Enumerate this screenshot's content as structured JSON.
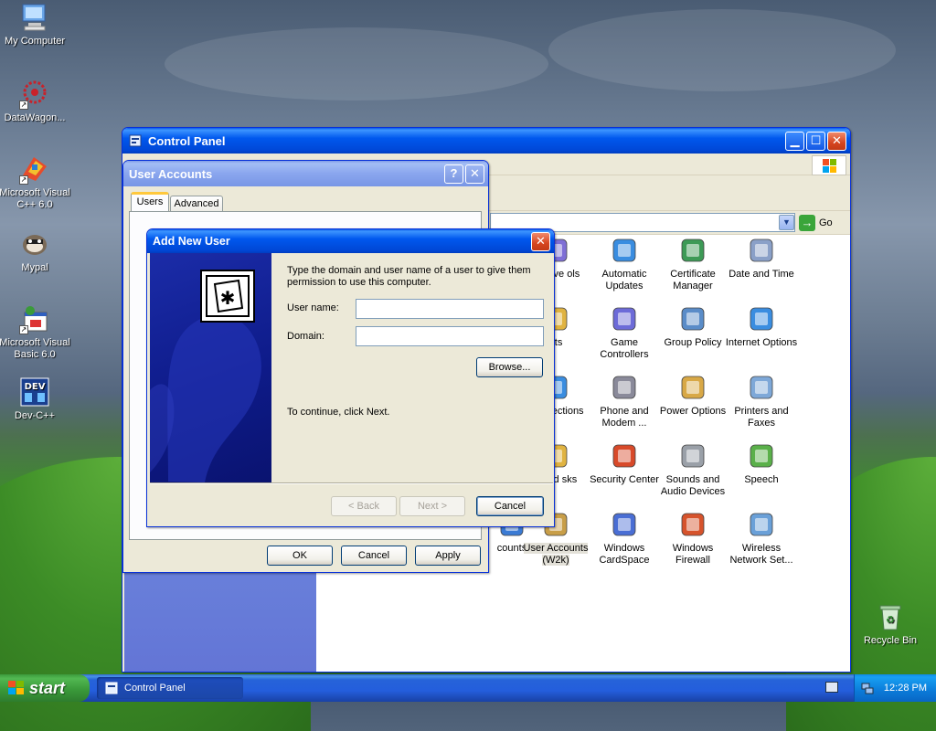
{
  "desktop": {
    "icons": [
      {
        "label": "My Computer"
      },
      {
        "label": "DataWagon..."
      },
      {
        "label": "Microsoft Visual C++ 6.0"
      },
      {
        "label": "Mypal"
      },
      {
        "label": "Microsoft Visual Basic 6.0"
      },
      {
        "label": "Dev-C++"
      },
      {
        "label": "Recycle Bin"
      }
    ]
  },
  "control_panel": {
    "title": "Control Panel",
    "go_label": "Go",
    "items": [
      {
        "label": "Administrative Tools",
        "visible": "strative ols"
      },
      {
        "label": "Automatic Updates"
      },
      {
        "label": "Certificate Manager"
      },
      {
        "label": "Date and Time"
      },
      {
        "label": "nts"
      },
      {
        "label": "Game Controllers"
      },
      {
        "label": "Group Policy"
      },
      {
        "label": "Internet Options"
      },
      {
        "label": "work ections"
      },
      {
        "label": "Phone and Modem ..."
      },
      {
        "label": "Power Options"
      },
      {
        "label": "Printers and Faxes"
      },
      {
        "label": "duled sks"
      },
      {
        "label": "Security Center"
      },
      {
        "label": "Sounds and Audio Devices"
      },
      {
        "label": "Speech"
      },
      {
        "label": "counts"
      },
      {
        "label": "User Accounts (W2k)"
      },
      {
        "label": "Windows CardSpace"
      },
      {
        "label": "Windows Firewall"
      },
      {
        "label": "Wireless Network Set..."
      }
    ]
  },
  "user_accounts": {
    "title": "User Accounts",
    "tabs": [
      "Users",
      "Advanced"
    ],
    "ok_label": "OK",
    "cancel_label": "Cancel",
    "apply_label": "Apply"
  },
  "add_user": {
    "title": "Add New User",
    "intro": "Type the domain and user name of a user to give them permission to use this computer.",
    "username_label": "User name:",
    "username_value": "",
    "domain_label": "Domain:",
    "domain_value": "",
    "browse_label": "Browse...",
    "continue_text": "To continue, click Next.",
    "back_label": "< Back",
    "next_label": "Next >",
    "cancel_label": "Cancel"
  },
  "taskbar": {
    "start_label": "start",
    "task_label": "Control Panel",
    "clock": "12:28 PM"
  },
  "colors": {
    "titlebar_blue": "#0058ee",
    "taskbar_blue": "#245edc",
    "start_green": "#3a9a3a"
  }
}
